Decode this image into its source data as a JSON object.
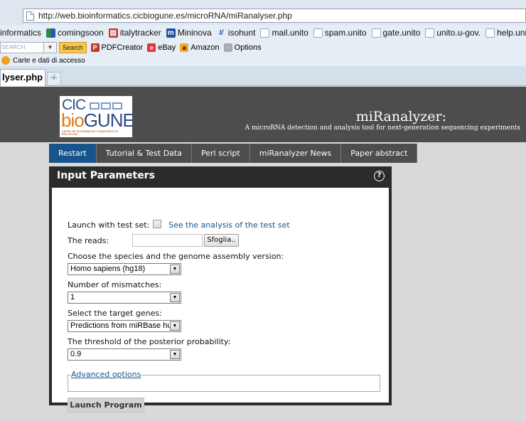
{
  "browser": {
    "url": "http://web.bioinformatics.cicbiogune.es/microRNA/miRanalyser.php",
    "bookmarks": [
      {
        "label": "informatics",
        "icon": "none"
      },
      {
        "label": "comingsoon",
        "icon": "multicolor-icon"
      },
      {
        "label": "italytracker",
        "icon": "italytracker-icon"
      },
      {
        "label": "Mininova",
        "icon": "mininova-icon"
      },
      {
        "label": "isohunt",
        "icon": "isohunt-icon"
      },
      {
        "label": "mail.unito",
        "icon": "page-icon"
      },
      {
        "label": "spam.unito",
        "icon": "page-icon"
      },
      {
        "label": "gate.unito",
        "icon": "page-icon"
      },
      {
        "label": "unito.u-gov.",
        "icon": "page-icon"
      },
      {
        "label": "help.unito",
        "icon": "page-icon"
      }
    ],
    "toolbar": {
      "search_placeholder": "SEARCH",
      "search_button": "Search",
      "pdfcreator": "PDFCreator",
      "ebay": "eBay",
      "amazon": "Amazon",
      "options": "Options"
    },
    "cards_label": "Carte e dati di accesso",
    "tab_title": "lyser.php",
    "newtab_label": "+"
  },
  "header": {
    "logo_top": "CIC",
    "logo_bio": "bio",
    "logo_gune": "GUNE",
    "logo_fine": "Centro de Investigación Cooperativa en Biociencias",
    "title": "miRanalyzer:",
    "subtitle": "A microRNA detection and analysis tool for next-generation sequencing experiments"
  },
  "nav": {
    "items": [
      "Restart",
      "Tutorial & Test Data",
      "Perl script",
      "miRanalyzer News",
      "Paper abstract"
    ]
  },
  "panel": {
    "title": "Input Parameters",
    "help": "?",
    "launch_test_label": "Launch with test set:",
    "test_link": "See the analysis of the test set",
    "reads_label": "The reads:",
    "browse_button": "Sfoglia..",
    "species_label": "Choose the species and the genome assembly version:",
    "species_value": "Homo sapiens (hg18)",
    "mismatch_label": "Number of mismatches:",
    "mismatch_value": "1",
    "target_label": "Select the target genes:",
    "target_value": "Predictions from miRBase hum",
    "threshold_label": "The threshold of the posterior probability:",
    "threshold_value": "0.9",
    "advanced": "Advanced options",
    "launch": "Launch Program"
  }
}
